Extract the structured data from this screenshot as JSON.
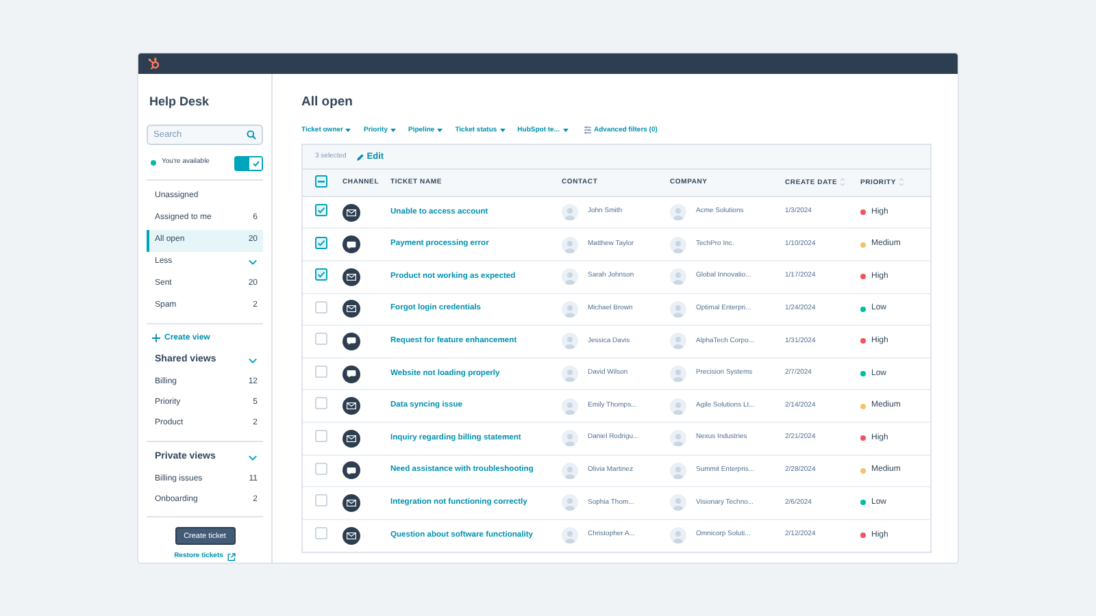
{
  "sidebar": {
    "title": "Help Desk",
    "search": {
      "placeholder": "Search"
    },
    "availability": {
      "label": "You're available",
      "on": true
    },
    "items": [
      {
        "label": "Unassigned",
        "selected": false,
        "kind": "view"
      },
      {
        "label": "Assigned to me",
        "count": "6",
        "selected": false,
        "kind": "view"
      },
      {
        "label": "All open",
        "count": "20",
        "selected": true,
        "kind": "view"
      },
      {
        "label": "Less",
        "selected": false,
        "kind": "toggle"
      },
      {
        "label": "Sent",
        "count": "20",
        "selected": false,
        "kind": "view"
      },
      {
        "label": "Spam",
        "count": "2",
        "selected": false,
        "kind": "view"
      }
    ],
    "create_view": "Create view",
    "sections": [
      {
        "title": "Shared views",
        "expanded": true,
        "items": [
          {
            "label": "Billing",
            "count": "12",
            "selected": false
          },
          {
            "label": "Priority",
            "count": "5",
            "selected": false
          },
          {
            "label": "Product",
            "count": "2",
            "selected": false
          }
        ]
      },
      {
        "title": "Private views",
        "expanded": true,
        "items": [
          {
            "label": "Billing issues",
            "count": "11",
            "selected": false
          },
          {
            "label": "Onboarding",
            "count": "2",
            "selected": false
          }
        ]
      }
    ],
    "create_button": "Create ticket",
    "restore_link": "Restore tickets"
  },
  "main": {
    "title": "All open",
    "filters": [
      {
        "label": "Ticket owner",
        "kind": "dropdown"
      },
      {
        "label": "Priority",
        "kind": "dropdown"
      },
      {
        "label": "Pipeline",
        "kind": "dropdown"
      },
      {
        "label": "Ticket status",
        "kind": "dropdown"
      },
      {
        "label": "HubSpot te...",
        "kind": "dropdown"
      },
      {
        "label": "Advanced filters (0)",
        "kind": "advanced"
      }
    ],
    "bulk_bar": {
      "selected_label": "3 selected",
      "edit_label": "Edit"
    },
    "table": {
      "indeterminate": true,
      "columns": [
        {
          "label": "CHANNEL",
          "sortable": false
        },
        {
          "label": "TICKET NAME",
          "sortable": false
        },
        {
          "label": "CONTACT",
          "sortable": false
        },
        {
          "label": "COMPANY",
          "sortable": false
        },
        {
          "label": "CREATE DATE",
          "sortable": true
        },
        {
          "label": "PRIORITY",
          "sortable": true
        }
      ],
      "rows": [
        {
          "selected": true,
          "kind": "email",
          "ticket_name": "Unable to access account",
          "contact": "John Smith",
          "company": "Acme Solutions",
          "create_date": "1/3/2024",
          "priority": "High",
          "color": "#f2545b"
        },
        {
          "selected": true,
          "kind": "chat",
          "ticket_name": "Payment processing error",
          "contact": "Matthew Taylor",
          "company": "TechPro Inc.",
          "create_date": "1/10/2024",
          "priority": "Medium",
          "color": "#f5c26b"
        },
        {
          "selected": true,
          "kind": "email",
          "ticket_name": "Product not working as expected",
          "contact": "Sarah Johnson",
          "company": "Global Innovatio...",
          "create_date": "1/17/2024",
          "priority": "High",
          "color": "#f2545b"
        },
        {
          "selected": false,
          "kind": "email",
          "ticket_name": "Forgot login credentials",
          "contact": "Michael Brown",
          "company": "Optimal Enterpri...",
          "create_date": "1/24/2024",
          "priority": "Low",
          "color": "#00bda5"
        },
        {
          "selected": false,
          "kind": "chat",
          "ticket_name": "Request for feature enhancement",
          "contact": "Jessica Davis",
          "company": "AlphaTech Corpo...",
          "create_date": "1/31/2024",
          "priority": "High",
          "color": "#f2545b"
        },
        {
          "selected": false,
          "kind": "chat",
          "ticket_name": "Website not loading properly",
          "contact": "David Wilson",
          "company": "Precision Systems",
          "create_date": "2/7/2024",
          "priority": "Low",
          "color": "#00bda5"
        },
        {
          "selected": false,
          "kind": "email",
          "ticket_name": "Data syncing issue",
          "contact": "Emily Thomps...",
          "company": "Agile Solutions Lt...",
          "create_date": "2/14/2024",
          "priority": "Medium",
          "color": "#f5c26b"
        },
        {
          "selected": false,
          "kind": "email",
          "ticket_name": "Inquiry regarding billing statement",
          "contact": "Daniel Rodrigu...",
          "company": "Nexus Industries",
          "create_date": "2/21/2024",
          "priority": "High",
          "color": "#f2545b"
        },
        {
          "selected": false,
          "kind": "chat",
          "ticket_name": "Need assistance with troubleshooting",
          "contact": "Olivia Martinez",
          "company": "Summit Enterpris...",
          "create_date": "2/28/2024",
          "priority": "Medium",
          "color": "#f5c26b"
        },
        {
          "selected": false,
          "kind": "email",
          "ticket_name": "Integration not functioning correctly",
          "contact": "Sophia Thom...",
          "company": "Visionary Techno...",
          "create_date": "2/6/2024",
          "priority": "Low",
          "color": "#00bda5"
        },
        {
          "selected": false,
          "kind": "email",
          "ticket_name": "Question about software functionality",
          "contact": "Christopher A...",
          "company": "Omnicorp Soluti...",
          "create_date": "2/12/2024",
          "priority": "High",
          "color": "#f2545b"
        }
      ]
    }
  }
}
